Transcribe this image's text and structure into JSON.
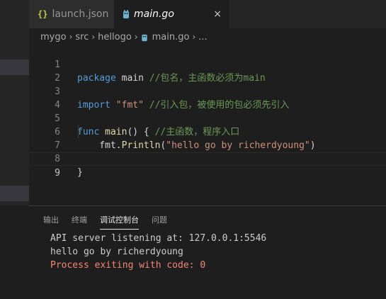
{
  "tabs": [
    {
      "icon": "{}",
      "label": "launch.json"
    },
    {
      "label": "main.go",
      "close": "×"
    }
  ],
  "breadcrumb": [
    "mygo",
    "src",
    "hellogo",
    "main.go",
    "..."
  ],
  "breadcrumb_sep": "›",
  "code": {
    "line_numbers": [
      "1",
      "2",
      "3",
      "4",
      "5",
      "6",
      "7",
      "8",
      "9"
    ],
    "l1": {
      "kw": "package",
      "name": " main ",
      "comment": "//包名，主函数必须为main"
    },
    "l3": {
      "kw": "import",
      "str": " \"fmt\"",
      "comment": " //引入包，被使用的包必须先引入"
    },
    "l5": {
      "kw": "func",
      "fn": " main",
      "rest": "() { ",
      "comment": "//主函数，程序入口"
    },
    "l6": {
      "obj": "    fmt.",
      "fn": "Println",
      "open": "(",
      "str": "\"hello go by richerdyoung\"",
      "close": ")"
    },
    "l8": {
      "text": "}"
    }
  },
  "panel": {
    "tabs": [
      "输出",
      "终端",
      "调试控制台",
      "问题"
    ],
    "active_tab": "调试控制台",
    "output": [
      "API server listening at: 127.0.0.1:5546",
      "hello go by richerdyoung",
      "Process exiting with code: 0"
    ]
  },
  "colors": {
    "keyword": "#569cd6",
    "string": "#ce9178",
    "comment": "#6a9955",
    "function": "#dcdcaa",
    "error": "#f48771"
  }
}
